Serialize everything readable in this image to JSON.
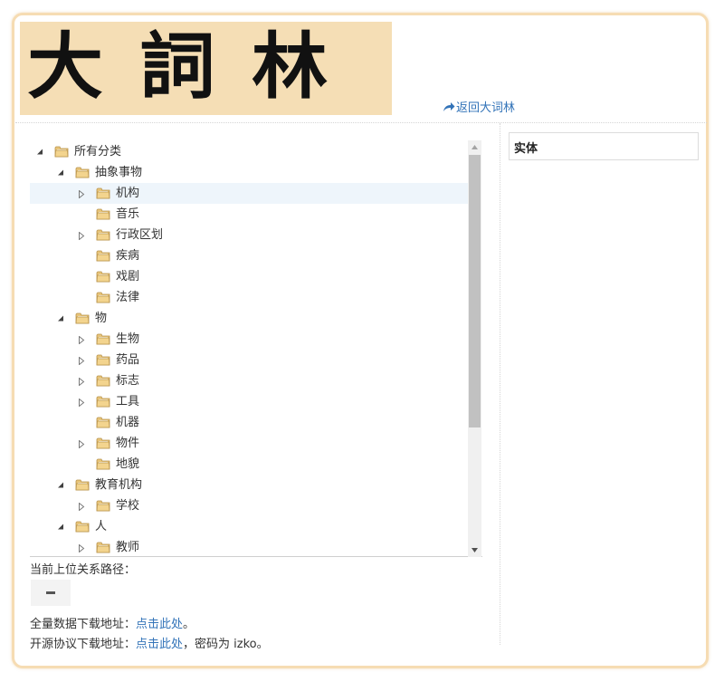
{
  "header": {
    "logo_text": "大詞林",
    "back_link": "返回大词林"
  },
  "tree": {
    "nodes": [
      {
        "label": "所有分类",
        "depth": 0,
        "state": "expanded",
        "selected": false
      },
      {
        "label": "抽象事物",
        "depth": 1,
        "state": "expanded",
        "selected": false
      },
      {
        "label": "机构",
        "depth": 2,
        "state": "collapsed",
        "selected": true
      },
      {
        "label": "音乐",
        "depth": 2,
        "state": "leaf",
        "selected": false
      },
      {
        "label": "行政区划",
        "depth": 2,
        "state": "collapsed",
        "selected": false
      },
      {
        "label": "疾病",
        "depth": 2,
        "state": "leaf",
        "selected": false
      },
      {
        "label": "戏剧",
        "depth": 2,
        "state": "leaf",
        "selected": false
      },
      {
        "label": "法律",
        "depth": 2,
        "state": "leaf",
        "selected": false
      },
      {
        "label": "物",
        "depth": 1,
        "state": "expanded",
        "selected": false
      },
      {
        "label": "生物",
        "depth": 2,
        "state": "collapsed",
        "selected": false
      },
      {
        "label": "药品",
        "depth": 2,
        "state": "collapsed",
        "selected": false
      },
      {
        "label": "标志",
        "depth": 2,
        "state": "collapsed",
        "selected": false
      },
      {
        "label": "工具",
        "depth": 2,
        "state": "collapsed",
        "selected": false
      },
      {
        "label": "机器",
        "depth": 2,
        "state": "leaf",
        "selected": false
      },
      {
        "label": "物件",
        "depth": 2,
        "state": "collapsed",
        "selected": false
      },
      {
        "label": "地貌",
        "depth": 2,
        "state": "leaf",
        "selected": false
      },
      {
        "label": "教育机构",
        "depth": 1,
        "state": "expanded",
        "selected": false
      },
      {
        "label": "学校",
        "depth": 2,
        "state": "collapsed",
        "selected": false
      },
      {
        "label": "人",
        "depth": 1,
        "state": "expanded",
        "selected": false
      },
      {
        "label": "教师",
        "depth": 2,
        "state": "collapsed",
        "selected": false
      }
    ]
  },
  "path": {
    "label": "当前上位关系路径：",
    "value": "—"
  },
  "downloads": {
    "full_label": "全量数据下载地址：",
    "full_link": "点击此处",
    "full_suffix": "。",
    "open_label": "开源协议下载地址：",
    "open_link": "点击此处",
    "open_suffix": "，密码为 izko。"
  },
  "entity_panel": {
    "title": "实体"
  },
  "colors": {
    "accent": "#3273b8",
    "frame": "#f6dcb3",
    "header_bg": "#f5deb5",
    "selected_row": "#eef5fb"
  },
  "icons": {
    "expanded": "triangle-down-icon",
    "collapsed": "triangle-right-icon",
    "folder": "folder-icon",
    "back": "share-arrow-icon"
  }
}
